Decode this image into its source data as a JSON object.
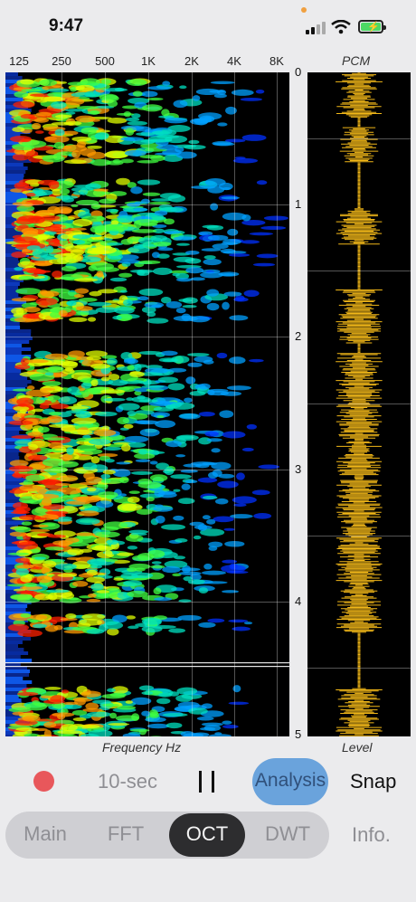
{
  "status_bar": {
    "time": "9:47"
  },
  "spectrogram": {
    "frequency_ticks": [
      "125",
      "250",
      "500",
      "1K",
      "2K",
      "4K",
      "8K"
    ],
    "time_ticks": [
      "0",
      "1",
      "2",
      "3",
      "4",
      "5"
    ],
    "x_caption": "Frequency Hz"
  },
  "pcm_panel": {
    "title": "PCM",
    "x_caption": "Level"
  },
  "controls": {
    "duration_label": "10-sec",
    "analysis_label": "Analysis",
    "snap_label": "Snap",
    "info_label": "Info."
  },
  "tabs": {
    "items": [
      "Main",
      "FFT",
      "OCT",
      "DWT"
    ],
    "selected": "OCT"
  },
  "colors": {
    "record": "#e8575b",
    "analysis_active": "#6aa3dc",
    "waveform": "#f2b818",
    "tab_selected": "#2d2d2f"
  }
}
